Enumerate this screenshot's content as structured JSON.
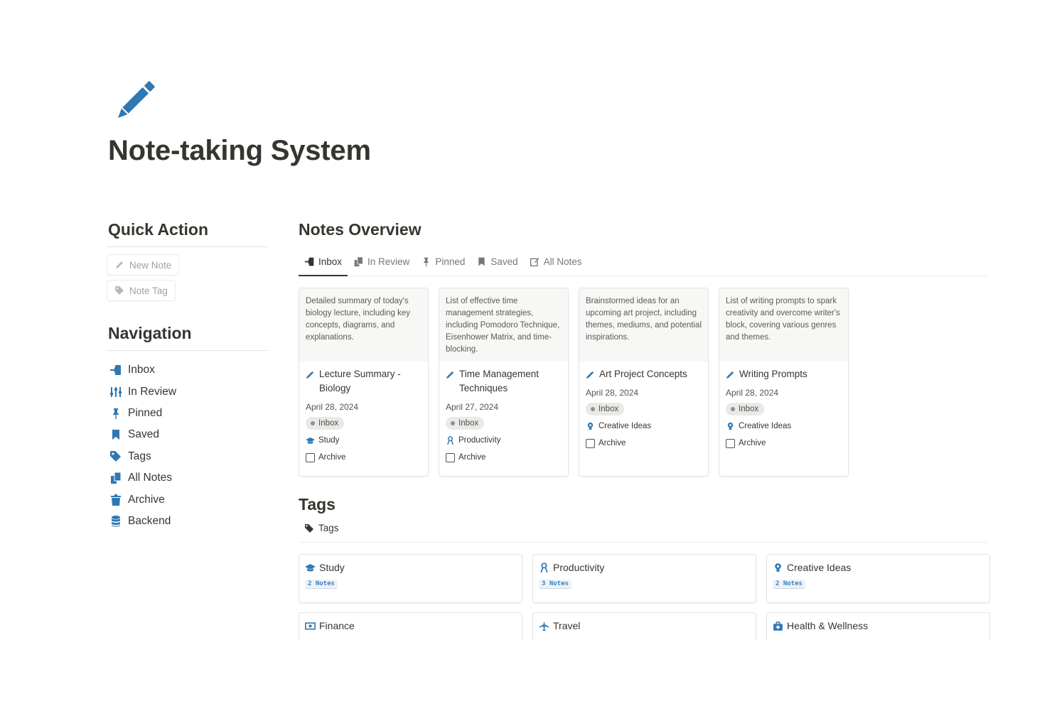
{
  "page": {
    "icon": "pencil-icon",
    "title": "Note-taking System"
  },
  "colors": {
    "accent": "#2f78b4",
    "text": "#37352f",
    "muted": "#787774"
  },
  "quick_action": {
    "heading": "Quick Action",
    "buttons": [
      {
        "label": "New Note",
        "icon": "pencil-icon"
      },
      {
        "label": "Note Tag",
        "icon": "tag-icon"
      }
    ]
  },
  "navigation": {
    "heading": "Navigation",
    "items": [
      {
        "label": "Inbox",
        "icon": "inbox-icon"
      },
      {
        "label": "In Review",
        "icon": "sliders-icon"
      },
      {
        "label": "Pinned",
        "icon": "pin-icon"
      },
      {
        "label": "Saved",
        "icon": "bookmark-icon"
      },
      {
        "label": "Tags",
        "icon": "tag-icon"
      },
      {
        "label": "All Notes",
        "icon": "documents-icon"
      },
      {
        "label": "Archive",
        "icon": "trash-icon"
      },
      {
        "label": "Backend",
        "icon": "database-icon"
      }
    ]
  },
  "notes_overview": {
    "heading": "Notes Overview",
    "tabs": [
      {
        "label": "Inbox",
        "icon": "inbox-icon",
        "active": true
      },
      {
        "label": "In Review",
        "icon": "documents-icon",
        "active": false
      },
      {
        "label": "Pinned",
        "icon": "pin-icon",
        "active": false
      },
      {
        "label": "Saved",
        "icon": "bookmark-icon",
        "active": false
      },
      {
        "label": "All Notes",
        "icon": "edit-icon",
        "active": false
      }
    ],
    "cards": [
      {
        "preview": "Detailed summary of today's biology lecture, including key concepts, diagrams, and explanations.",
        "title": "Lecture Summary - Biology",
        "date": "April 28, 2024",
        "status": "Inbox",
        "tag": "Study",
        "tag_icon": "graduation-cap-icon",
        "archive_label": "Archive"
      },
      {
        "preview": "List of effective time management strategies, including Pomodoro Technique, Eisenhower Matrix, and time-blocking.",
        "title": "Time Management Techniques",
        "date": "April 27, 2024",
        "status": "Inbox",
        "tag": "Productivity",
        "tag_icon": "person-icon",
        "archive_label": "Archive"
      },
      {
        "preview": "Brainstormed ideas for an upcoming art project, including themes, mediums, and potential inspirations.",
        "title": "Art Project Concepts",
        "date": "April 28, 2024",
        "status": "Inbox",
        "tag": "Creative Ideas",
        "tag_icon": "lightbulb-icon",
        "archive_label": "Archive"
      },
      {
        "preview": "List of writing prompts to spark creativity and overcome writer's block, covering various genres and themes.",
        "title": "Writing Prompts",
        "date": "April 28, 2024",
        "status": "Inbox",
        "tag": "Creative Ideas",
        "tag_icon": "lightbulb-icon",
        "archive_label": "Archive"
      }
    ]
  },
  "tags": {
    "heading": "Tags",
    "tab_label": "Tags",
    "items": [
      {
        "name": "Study",
        "icon": "graduation-cap-icon",
        "count": "2 Notes"
      },
      {
        "name": "Productivity",
        "icon": "person-icon",
        "count": "3 Notes"
      },
      {
        "name": "Creative Ideas",
        "icon": "lightbulb-icon",
        "count": "2 Notes"
      },
      {
        "name": "Finance",
        "icon": "money-icon",
        "count": ""
      },
      {
        "name": "Travel",
        "icon": "airplane-icon",
        "count": ""
      },
      {
        "name": "Health & Wellness",
        "icon": "first-aid-icon",
        "count": ""
      }
    ]
  }
}
